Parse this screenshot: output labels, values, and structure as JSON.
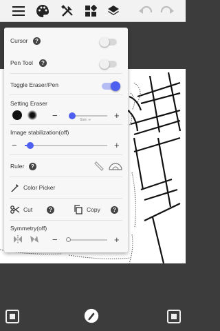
{
  "toolbar": {
    "icons": [
      "menu-icon",
      "palette-icon",
      "tools-icon",
      "layers-grid-icon",
      "layers-stack-icon",
      "undo-icon",
      "redo-icon"
    ]
  },
  "panel": {
    "cursor": {
      "label": "Cursor",
      "on": false
    },
    "pen_tool": {
      "label": "Pen Tool",
      "on": false
    },
    "toggle_eraser": {
      "label": "Toggle Eraser/Pen",
      "on": true
    },
    "setting_eraser": {
      "label": "Setting Eraser",
      "size_label": "Size: ∞",
      "level": 0.1
    },
    "stabilization": {
      "label": "Image stabilization(off)",
      "level": 0.15
    },
    "ruler": {
      "label": "Ruler"
    },
    "color_picker": {
      "label": "Color Picker"
    },
    "cut": {
      "label": "Cut"
    },
    "copy": {
      "label": "Copy"
    },
    "symmetry": {
      "label": "Symmetry(off)",
      "level": 0.0
    }
  },
  "colors": {
    "accent": "#4f5ff0",
    "panel_bg": "#f7f7f7",
    "toolbar_bg": "#f2f2f2",
    "dark_bg": "#3c3c3c"
  },
  "bottom": {
    "icons": [
      "fullscreen-left-icon",
      "pen-tool-icon",
      "fullscreen-right-icon"
    ]
  },
  "help_glyph": "?"
}
